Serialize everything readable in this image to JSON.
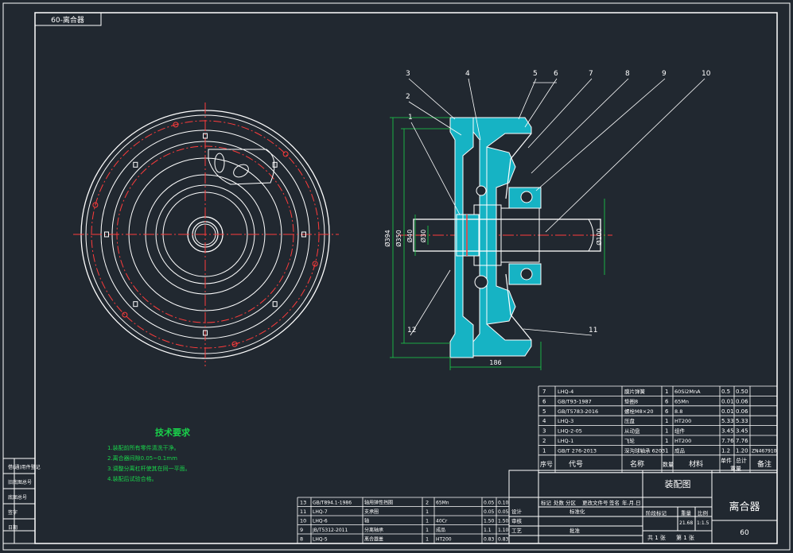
{
  "colors": {
    "background": "#212830",
    "line": "#ffffff",
    "centerline": "#ff3b3b",
    "hatch": "#16b3c4",
    "dim": "#19d24a",
    "note": "#19d24a",
    "title_text": "#ffffff"
  },
  "corner_code": "60-离合器",
  "balloons": [
    "1",
    "2",
    "3",
    "4",
    "5",
    "6",
    "7",
    "8",
    "9",
    "10",
    "11",
    "12"
  ],
  "dims": {
    "overall_height": "Ø394",
    "outer_dia": "Ø350",
    "shaft_left": "Ø40",
    "shaft_inner": "Ø30",
    "shaft_right": "Ø100",
    "length": "186"
  },
  "tech_notes": {
    "title": "技术要求",
    "items": [
      "1.装配前所有零件清洗干净。",
      "2.离合器间隙0.05~0.1mm",
      "3.调整分离杠杆使其在同一平面。",
      "4.装配后试验合格。"
    ]
  },
  "bom_upper": [
    {
      "no": "7",
      "code": "LHQ-4",
      "name": "膜片弹簧",
      "qty": "1",
      "material": "60Si2MnA",
      "unit": "0.5",
      "total": "0.50",
      "note": ""
    },
    {
      "no": "6",
      "code": "GB/T93-1987",
      "name": "垫圈8",
      "qty": "6",
      "material": "65Mn",
      "unit": "0.01",
      "total": "0.06",
      "note": ""
    },
    {
      "no": "5",
      "code": "GB/T5783-2016",
      "name": "螺栓M8×20",
      "qty": "6",
      "material": "8.8",
      "unit": "0.01",
      "total": "0.06",
      "note": ""
    },
    {
      "no": "4",
      "code": "LHQ-3",
      "name": "压盘",
      "qty": "1",
      "material": "HT200",
      "unit": "5.33",
      "total": "5.33",
      "note": ""
    },
    {
      "no": "3",
      "code": "LHQ-2-05",
      "name": "从动盘",
      "qty": "1",
      "material": "组件",
      "unit": "3.45",
      "total": "3.45",
      "note": ""
    },
    {
      "no": "2",
      "code": "LHQ-1",
      "name": "飞轮",
      "qty": "1",
      "material": "HT200",
      "unit": "7.76",
      "total": "7.76",
      "note": ""
    },
    {
      "no": "1",
      "code": "GB/T 276-2013",
      "name": "深沟球轴承 6203",
      "qty": "1",
      "material": "成品",
      "unit": "1.2",
      "total": "1.20",
      "note": "ZN467910"
    }
  ],
  "bom_upper_header": {
    "no": "序号",
    "code": "代号",
    "name": "名称",
    "qty": "数量",
    "material": "材料",
    "unit": "单件",
    "total": "总计",
    "weight": "重量",
    "note": "备注"
  },
  "bom_lower": [
    {
      "no": "13",
      "code": "GB/T894.1-1986",
      "name": "轴用弹性挡圈",
      "qty": "2",
      "material": "65Mn",
      "unit": "0.05",
      "total": "0.10"
    },
    {
      "no": "11",
      "code": "LHQ-7",
      "name": "支承圈",
      "qty": "1",
      "material": "",
      "unit": "0.05",
      "total": "0.05"
    },
    {
      "no": "10",
      "code": "LHQ-6",
      "name": "轴",
      "qty": "1",
      "material": "40Cr",
      "unit": "1.50",
      "total": "1.50"
    },
    {
      "no": "9",
      "code": "JB/T5312-2011",
      "name": "分离轴承",
      "qty": "1",
      "material": "成品",
      "unit": "1.1",
      "total": "1.10"
    },
    {
      "no": "8",
      "code": "LHQ-5",
      "name": "离合器盖",
      "qty": "1",
      "material": "HT200",
      "unit": "0.83",
      "total": "0.83"
    }
  ],
  "title_block": {
    "drawing_type": "装配图",
    "name": "离合器",
    "code": "60",
    "labels": {
      "mark": "标记",
      "count": "处数",
      "zone": "分区",
      "change_doc": "更改文件号",
      "sign": "签名",
      "date": "年.月.日",
      "design": "设计",
      "standard": "标准化",
      "stage": "阶段标记",
      "weight": "重量",
      "scale": "比例",
      "review": "审核",
      "process": "工艺",
      "approve": "批准"
    },
    "weight_value": "21.68",
    "scale_value": "1:1.5",
    "sheets": "共 1 张",
    "sheet_no": "第 1 张"
  },
  "left_strip": [
    "借(通)用件登记",
    "旧底图总号",
    "底图总号",
    "签字",
    "日期"
  ]
}
